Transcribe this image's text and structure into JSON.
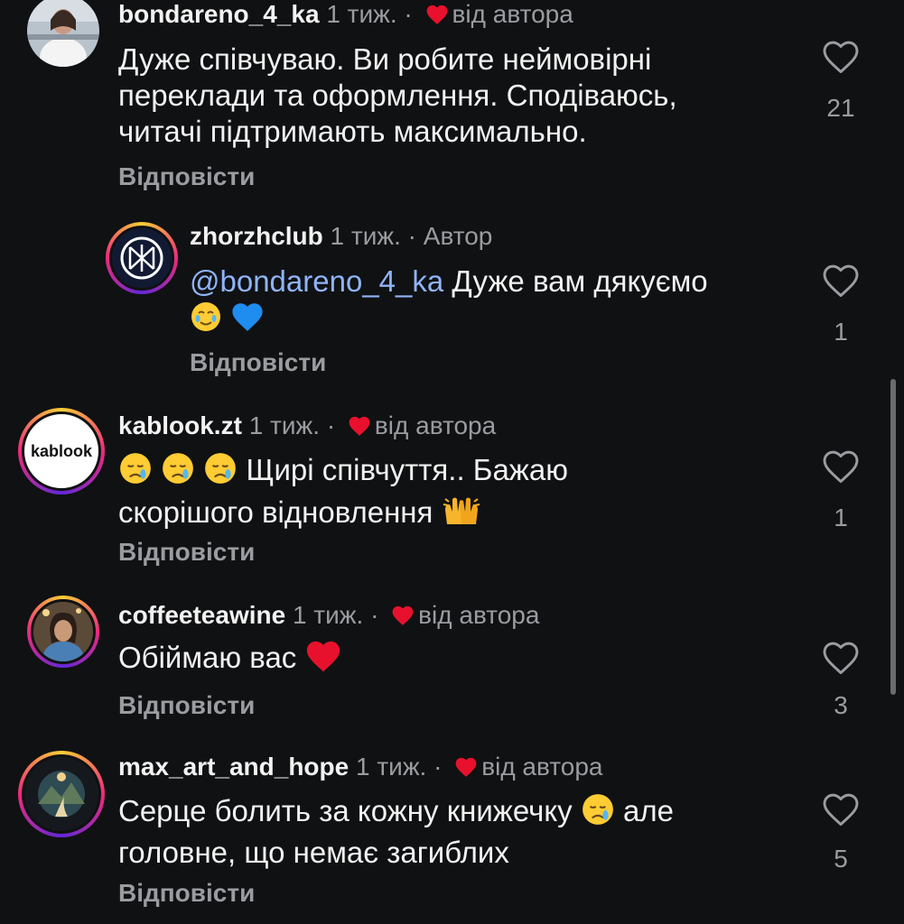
{
  "comments": [
    {
      "username": "bondareno_4_ka",
      "time": "1 тиж.",
      "sep": "·",
      "author_badge": "від автора",
      "text": "Дуже співчуваю. Ви робите неймовірні переклади та оформлення. Сподіваюсь, читачі підтримають максимально.",
      "reply_label": "Відповісти",
      "likes": "21"
    },
    {
      "username": "zhorzhclub",
      "time": "1 тиж.",
      "sep": "·",
      "author_badge": "Автор",
      "mention": "@bondareno_4_ka",
      "text": "Дуже вам дякуємо",
      "reply_label": "Відповісти",
      "likes": "1"
    },
    {
      "username": "kablook.zt",
      "time": "1 тиж.",
      "sep": "·",
      "author_badge": "від автора",
      "text_line1": "Щирі співчуття.. Бажаю",
      "text_line2": "скорішого відновлення",
      "avatar_text": "kablook",
      "reply_label": "Відповісти",
      "likes": "1"
    },
    {
      "username": "coffeeteawine",
      "time": "1 тиж.",
      "sep": "·",
      "author_badge": "від автора",
      "text": "Обіймаю вас",
      "reply_label": "Відповісти",
      "likes": "3"
    },
    {
      "username": "max_art_and_hope",
      "time": "1 тиж.",
      "sep": "·",
      "author_badge": "від автора",
      "text_line1": "Серце болить за кожну книжечку",
      "text_line1_after": "але",
      "text_line2": "головне, що немає загиблих",
      "reply_label": "Відповісти",
      "likes": "5"
    }
  ],
  "colors": {
    "background": "#101113",
    "text": "#f2f2f2",
    "muted": "#9a9ca0",
    "heart_red": "#e8112d",
    "mention": "#8fb4f8"
  },
  "icons": {
    "like": "heart-outline-icon",
    "author_like": "heart-filled-icon"
  }
}
